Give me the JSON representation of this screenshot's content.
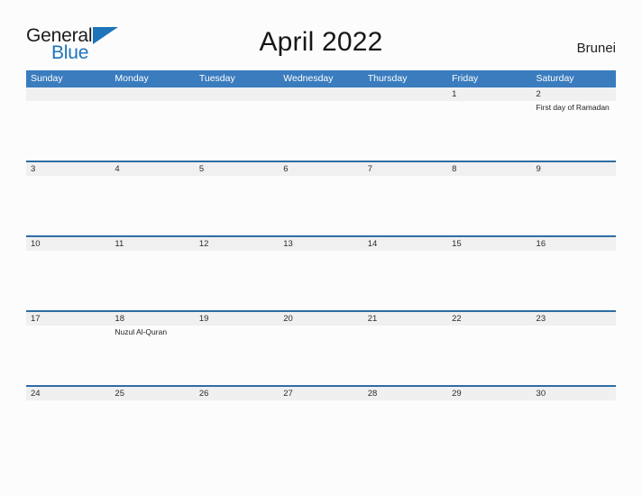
{
  "brand": {
    "name_part1": "General",
    "name_part2": "Blue",
    "flag_icon": "blue-flag-triangle"
  },
  "header": {
    "title": "April 2022",
    "country": "Brunei"
  },
  "calendar": {
    "month": "April",
    "year": "2022",
    "day_headers": [
      "Sunday",
      "Monday",
      "Tuesday",
      "Wednesday",
      "Thursday",
      "Friday",
      "Saturday"
    ],
    "colors": {
      "header_blue": "#3a7cbe",
      "row_divider_blue": "#2e6da4",
      "date_band_gray": "#f0f0f0",
      "page_background": "#fcfcfc",
      "logo_blue": "#1d74ba"
    },
    "weeks": [
      {
        "days": [
          {
            "num": "",
            "event": ""
          },
          {
            "num": "",
            "event": ""
          },
          {
            "num": "",
            "event": ""
          },
          {
            "num": "",
            "event": ""
          },
          {
            "num": "",
            "event": ""
          },
          {
            "num": "1",
            "event": ""
          },
          {
            "num": "2",
            "event": "First day of Ramadan"
          }
        ]
      },
      {
        "days": [
          {
            "num": "3",
            "event": ""
          },
          {
            "num": "4",
            "event": ""
          },
          {
            "num": "5",
            "event": ""
          },
          {
            "num": "6",
            "event": ""
          },
          {
            "num": "7",
            "event": ""
          },
          {
            "num": "8",
            "event": ""
          },
          {
            "num": "9",
            "event": ""
          }
        ]
      },
      {
        "days": [
          {
            "num": "10",
            "event": ""
          },
          {
            "num": "11",
            "event": ""
          },
          {
            "num": "12",
            "event": ""
          },
          {
            "num": "13",
            "event": ""
          },
          {
            "num": "14",
            "event": ""
          },
          {
            "num": "15",
            "event": ""
          },
          {
            "num": "16",
            "event": ""
          }
        ]
      },
      {
        "days": [
          {
            "num": "17",
            "event": ""
          },
          {
            "num": "18",
            "event": "Nuzul Al-Quran"
          },
          {
            "num": "19",
            "event": ""
          },
          {
            "num": "20",
            "event": ""
          },
          {
            "num": "21",
            "event": ""
          },
          {
            "num": "22",
            "event": ""
          },
          {
            "num": "23",
            "event": ""
          }
        ]
      },
      {
        "days": [
          {
            "num": "24",
            "event": ""
          },
          {
            "num": "25",
            "event": ""
          },
          {
            "num": "26",
            "event": ""
          },
          {
            "num": "27",
            "event": ""
          },
          {
            "num": "28",
            "event": ""
          },
          {
            "num": "29",
            "event": ""
          },
          {
            "num": "30",
            "event": ""
          }
        ]
      }
    ]
  }
}
